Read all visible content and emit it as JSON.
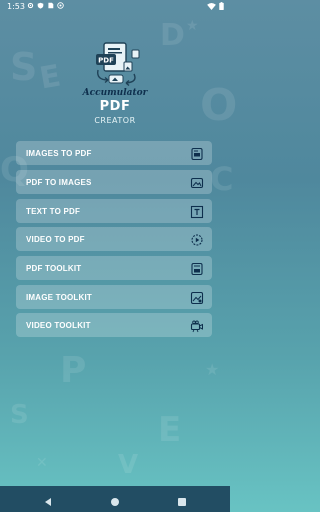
{
  "status_bar": {
    "time": "1:53"
  },
  "brand": {
    "script": "Accumulator",
    "title": "PDF",
    "subtitle": "CREATOR",
    "logo_text": "PDF"
  },
  "menu": [
    {
      "label": "IMAGES TO PDF",
      "icon": "images-to-pdf-icon"
    },
    {
      "label": "PDF TO IMAGES",
      "icon": "image-icon"
    },
    {
      "label": "TEXT TO PDF",
      "icon": "text-icon"
    },
    {
      "label": "VIDEO TO PDF",
      "icon": "video-icon"
    },
    {
      "label": "PDF TOOLKIT",
      "icon": "toolkit-icon"
    },
    {
      "label": "IMAGE TOOLKIT",
      "icon": "image-toolkit-icon"
    },
    {
      "label": "VIDEO TOOLKIT",
      "icon": "video-camera-icon"
    }
  ],
  "colors": {
    "brand_script": "#0e2f4d",
    "nav_bar": "#224d63",
    "button_bg": "rgba(255,255,255,0.22)"
  }
}
